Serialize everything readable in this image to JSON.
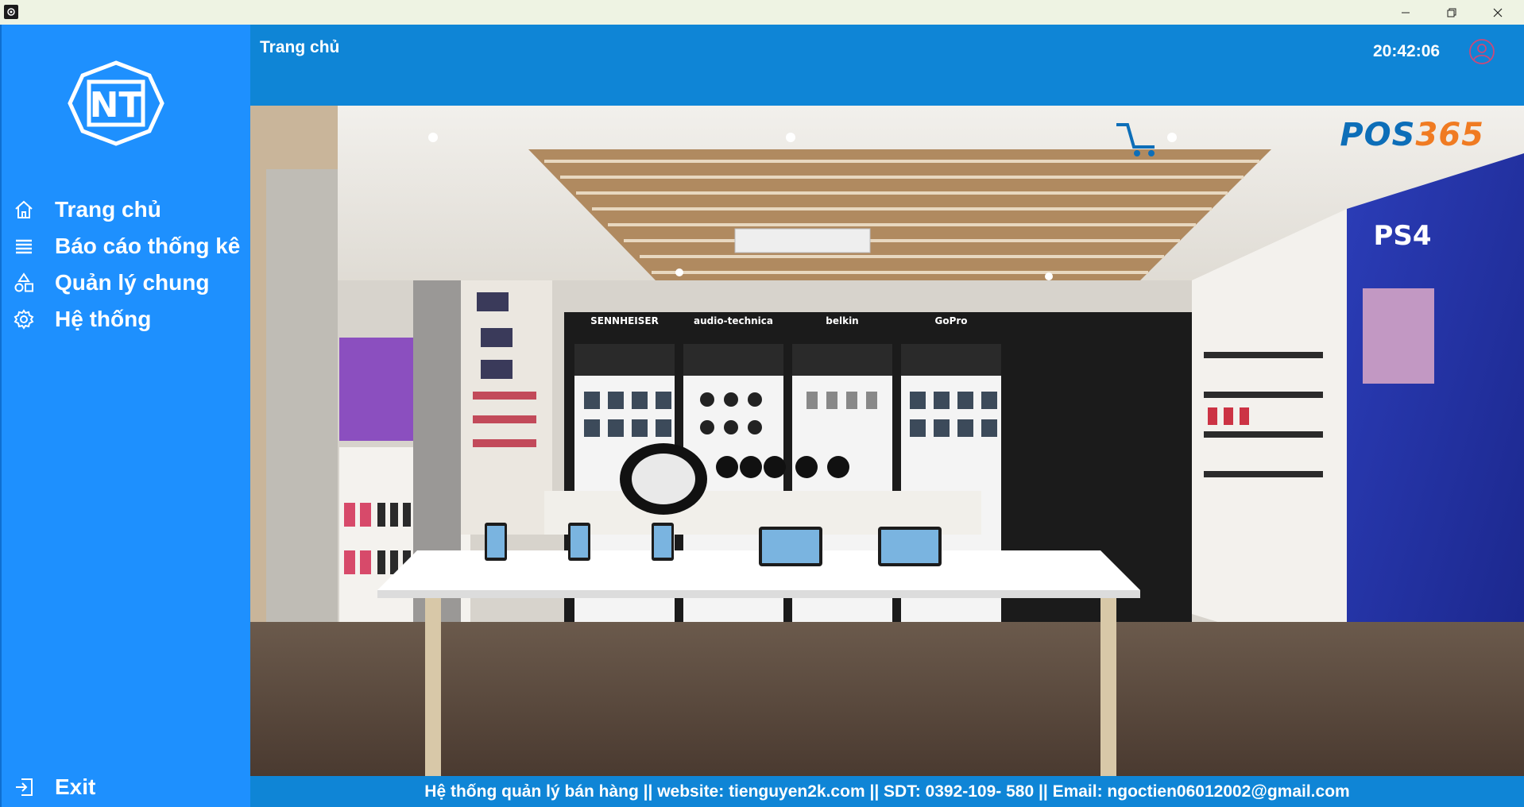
{
  "window": {
    "controls": {
      "minimize_icon": "minimize-icon",
      "maximize_icon": "restore-icon",
      "close_icon": "close-icon"
    }
  },
  "sidebar": {
    "logo_text": "NT",
    "items": [
      {
        "label": "Trang chủ",
        "icon": "home-icon"
      },
      {
        "label": "Báo cáo thống kê",
        "icon": "list-icon"
      },
      {
        "label": "Quản lý chung",
        "icon": "shapes-icon"
      },
      {
        "label": "Hệ thống",
        "icon": "gear-icon"
      }
    ],
    "exit_label": "Exit"
  },
  "header": {
    "title": "Trang chủ",
    "time": "20:42:06",
    "user_icon": "user-avatar-icon"
  },
  "hero": {
    "brand_main": "POS",
    "brand_num": "365",
    "store_brands": [
      "SENNHEISER",
      "audio-technica",
      "belkin",
      "GoPro",
      "PS4"
    ]
  },
  "footer": {
    "text": "Hệ thống quản lý bán hàng || website: tienguyen2k.com ||  SDT: 0392-109- 580 || Email: ngoctien06012002@gmail.com"
  },
  "colors": {
    "sidebar": "#1e90fe",
    "header": "#0f85d6",
    "titlebar": "#eef3e3",
    "brand_blue": "#0d6eb8",
    "brand_orange": "#f07b22"
  }
}
